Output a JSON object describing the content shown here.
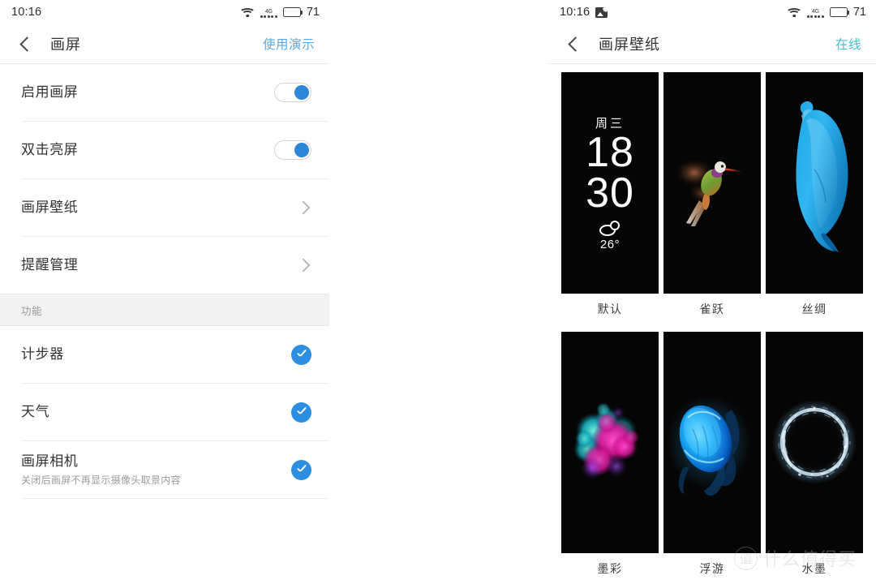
{
  "left_screen": {
    "statusbar": {
      "time": "10:16",
      "wifi_icon": "wifi-icon",
      "network_label": "4G",
      "signal_icon": "signal-dots-icon",
      "battery_icon": "battery-icon",
      "battery_level": "71"
    },
    "navbar": {
      "back_icon": "back-chevron-icon",
      "title": "画屏",
      "action": "使用演示",
      "action_color": "#5aa9e6"
    },
    "rows": [
      {
        "title": "启用画屏",
        "sub": "",
        "control": "toggle",
        "state": "on"
      },
      {
        "title": "双击亮屏",
        "sub": "",
        "control": "toggle",
        "state": "on"
      },
      {
        "title": "画屏壁纸",
        "sub": "",
        "control": "chevron",
        "state": ""
      },
      {
        "title": "提醒管理",
        "sub": "",
        "control": "chevron",
        "state": ""
      }
    ],
    "section_header": "功能",
    "feature_rows": [
      {
        "title": "计步器",
        "sub": "",
        "control": "check",
        "state": "checked"
      },
      {
        "title": "天气",
        "sub": "",
        "control": "check",
        "state": "checked"
      },
      {
        "title": "画屏相机",
        "sub": "关闭后画屏不再显示摄像头取景内容",
        "control": "check",
        "state": "checked"
      }
    ]
  },
  "right_screen": {
    "statusbar": {
      "time": "10:16",
      "photo_icon": "screenshot-icon",
      "wifi_icon": "wifi-icon",
      "network_label": "4G",
      "signal_icon": "signal-dots-icon",
      "battery_icon": "battery-icon",
      "battery_level": "71"
    },
    "navbar": {
      "back_icon": "back-chevron-icon",
      "title": "画屏壁纸",
      "action": "在线",
      "action_color": "#3fbfd4"
    },
    "wallpapers": [
      {
        "label": "默认",
        "art": "clock",
        "clock": {
          "weekday": "周三",
          "hour": "18",
          "minute": "30",
          "weather_icon": "cloud-icon",
          "temperature": "26°"
        }
      },
      {
        "label": "雀跃",
        "art": "bird"
      },
      {
        "label": "丝绸",
        "art": "silk"
      },
      {
        "label": "墨彩",
        "art": "ink"
      },
      {
        "label": "浮游",
        "art": "jelly"
      },
      {
        "label": "水墨",
        "art": "ring"
      }
    ]
  },
  "watermark": {
    "badge": "值",
    "text": "什么值得买"
  },
  "colors": {
    "accent_blue": "#2b8ee0",
    "toggle_knob": "#2d86d8",
    "link_blue": "#5aa9e6",
    "teal": "#3fbfd4",
    "section_bg": "#f2f2f2",
    "divider": "#ededed",
    "thumb_bg": "#050505"
  }
}
